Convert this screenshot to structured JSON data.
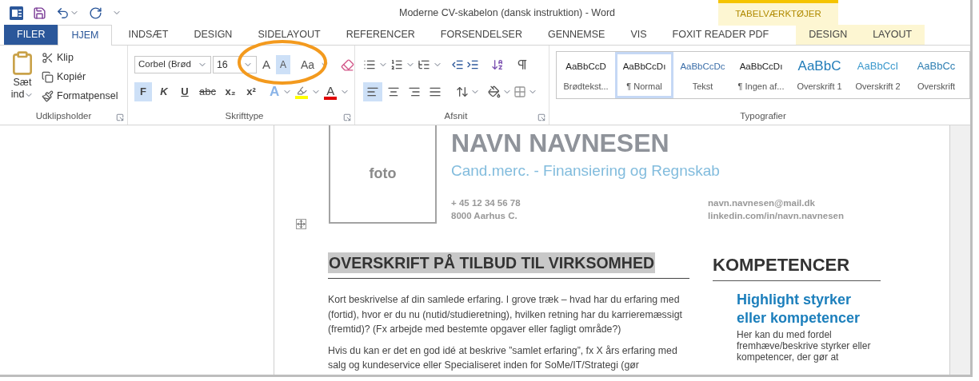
{
  "window": {
    "title": "Moderne CV-skabelon (dansk instruktion) - Word",
    "context_label": "TABELVÆRKTØJER"
  },
  "tabs": [
    {
      "label": "FILER",
      "kind": "file",
      "selected": false
    },
    {
      "label": "HJEM",
      "kind": "normal",
      "selected": true
    },
    {
      "label": "INDSÆT",
      "kind": "normal",
      "selected": false
    },
    {
      "label": "DESIGN",
      "kind": "normal",
      "selected": false
    },
    {
      "label": "SIDELAYOUT",
      "kind": "normal",
      "selected": false
    },
    {
      "label": "REFERENCER",
      "kind": "normal",
      "selected": false
    },
    {
      "label": "FORSENDELSER",
      "kind": "normal",
      "selected": false
    },
    {
      "label": "GENNEMSE",
      "kind": "normal",
      "selected": false
    },
    {
      "label": "VIS",
      "kind": "normal",
      "selected": false
    },
    {
      "label": "FOXIT READER PDF",
      "kind": "normal",
      "selected": false
    },
    {
      "label": "DESIGN",
      "kind": "context",
      "selected": false
    },
    {
      "label": "LAYOUT",
      "kind": "context",
      "selected": false
    }
  ],
  "clipboard": {
    "paste_label": "Sæt",
    "paste_label_2": "ind",
    "items": [
      "Klip",
      "Kopiér",
      "Formatpensel"
    ],
    "label": "Udklipsholder"
  },
  "font": {
    "font_name": "Corbel (Brød",
    "font_size": "16",
    "label": "Skrifttype",
    "size_buttons": [
      {
        "label": "A",
        "kind": "grow",
        "active": false
      },
      {
        "label": "A",
        "kind": "shrink",
        "active": true
      },
      {
        "label": "Aa",
        "kind": "case",
        "active": false
      }
    ],
    "format_buttons": [
      {
        "label": "F",
        "kind": "bold",
        "active": true
      },
      {
        "label": "K",
        "kind": "italic",
        "active": false
      },
      {
        "label": "U",
        "kind": "underline",
        "active": false
      },
      {
        "label": "abc",
        "kind": "strike",
        "active": false
      },
      {
        "label": "x₂",
        "kind": "sub",
        "active": false
      },
      {
        "label": "x²",
        "kind": "sup",
        "active": false
      }
    ],
    "effects_label": "A",
    "color_label": "A"
  },
  "paragraph": {
    "label": "Afsnit",
    "align": [
      {
        "kind": "left",
        "selected": true
      },
      {
        "kind": "center",
        "selected": false
      },
      {
        "kind": "right",
        "selected": false
      },
      {
        "kind": "justify",
        "selected": false
      }
    ]
  },
  "styles": {
    "label": "Typografier",
    "items": [
      {
        "sample": "AaBbCcD",
        "name": "Brødtekst...",
        "kind": "body",
        "color": "#222222",
        "selected": false
      },
      {
        "sample": "AaBbCcDı",
        "name": "¶ Normal",
        "kind": "body",
        "color": "#222222",
        "selected": true
      },
      {
        "sample": "AaBbCcDc",
        "name": "Tekst",
        "kind": "body",
        "color": "#3b6ea8",
        "selected": false
      },
      {
        "sample": "AaBbCcDı",
        "name": "¶ Ingen af...",
        "kind": "body",
        "color": "#222222",
        "selected": false
      },
      {
        "sample": "AaBbC",
        "name": "Overskrift 1",
        "kind": "heading1",
        "color": "#1f7bb8",
        "selected": false
      },
      {
        "sample": "AaBbCcI",
        "name": "Overskrift 2",
        "kind": "heading2",
        "color": "#3a98cc",
        "selected": false
      },
      {
        "sample": "AaBbCc",
        "name": "Overskrift",
        "kind": "heading2",
        "color": "#2f7fb2",
        "selected": false
      }
    ]
  },
  "document": {
    "photo_label": "foto",
    "name": "NAVN NAVNESEN",
    "subtitle": "Cand.merc. - Finansiering og Regnskab",
    "phone": "+ 45 12 34 56 78",
    "city": "8000 Aarhus C.",
    "email": "navn.navnesen@mail.dk",
    "linkedin": "linkedin.com/in/navn.navnesen",
    "left_heading": "OVERSKRIFT PÅ TILBUD TIL VIRKSOMHED",
    "paragraphs": [
      "Kort beskrivelse af din samlede erfaring. I grove træk – hvad har du erfaring med (fortid), hvor er du nu (nutid/studieretning), hvilken retning har du karrieremæssigt (fremtid)? (Fx arbejde med bestemte opgaver eller fagligt område?)",
      "Hvis du kan er det en god idé at beskrive ”samlet erfaring”, fx X års erfaring med salg og kundeservice eller Specialiseret inden for SoMe/IT/Strategi (gør"
    ],
    "right_heading": "KOMPETENCER",
    "sub_heading": "Highlight styrker eller kompetencer",
    "right_text": "Her kan du med fordel fremhæve/beskrive styrker eller kompetencer, der gør at"
  }
}
